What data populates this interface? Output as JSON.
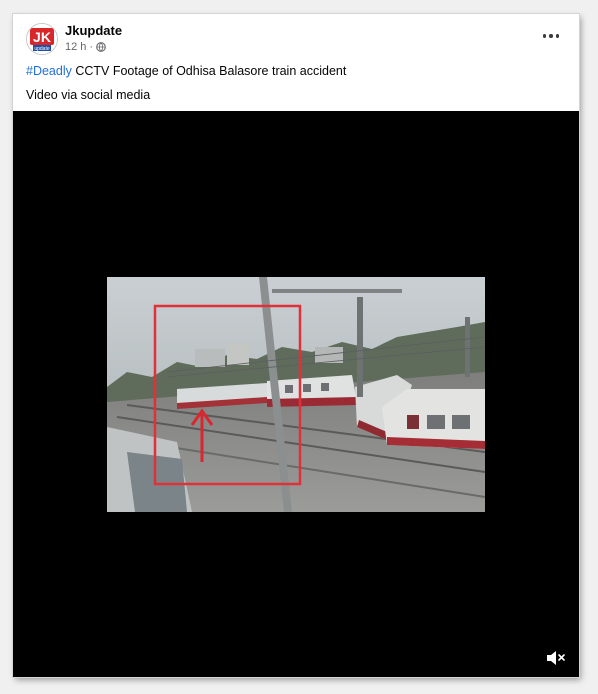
{
  "post": {
    "page_name": "Jkupdate",
    "time": "12 h",
    "dot": "·",
    "hashtag": "#Deadly",
    "headline": " CCTV Footage of Odhisa Balasore train accident",
    "caption": "Video via social media"
  },
  "avatar": {
    "logo_letters": "JK",
    "logo_sub": "update"
  },
  "icons": {
    "privacy": "globe-icon",
    "menu": "more-options-icon",
    "volume": "speaker-muted-icon",
    "annotation": "red-arrow-icon"
  },
  "colors": {
    "hashtag": "#216fdb",
    "video_bg": "#000000",
    "annotation_red": "#e0303a",
    "text": "#050505",
    "meta": "#65676b"
  }
}
